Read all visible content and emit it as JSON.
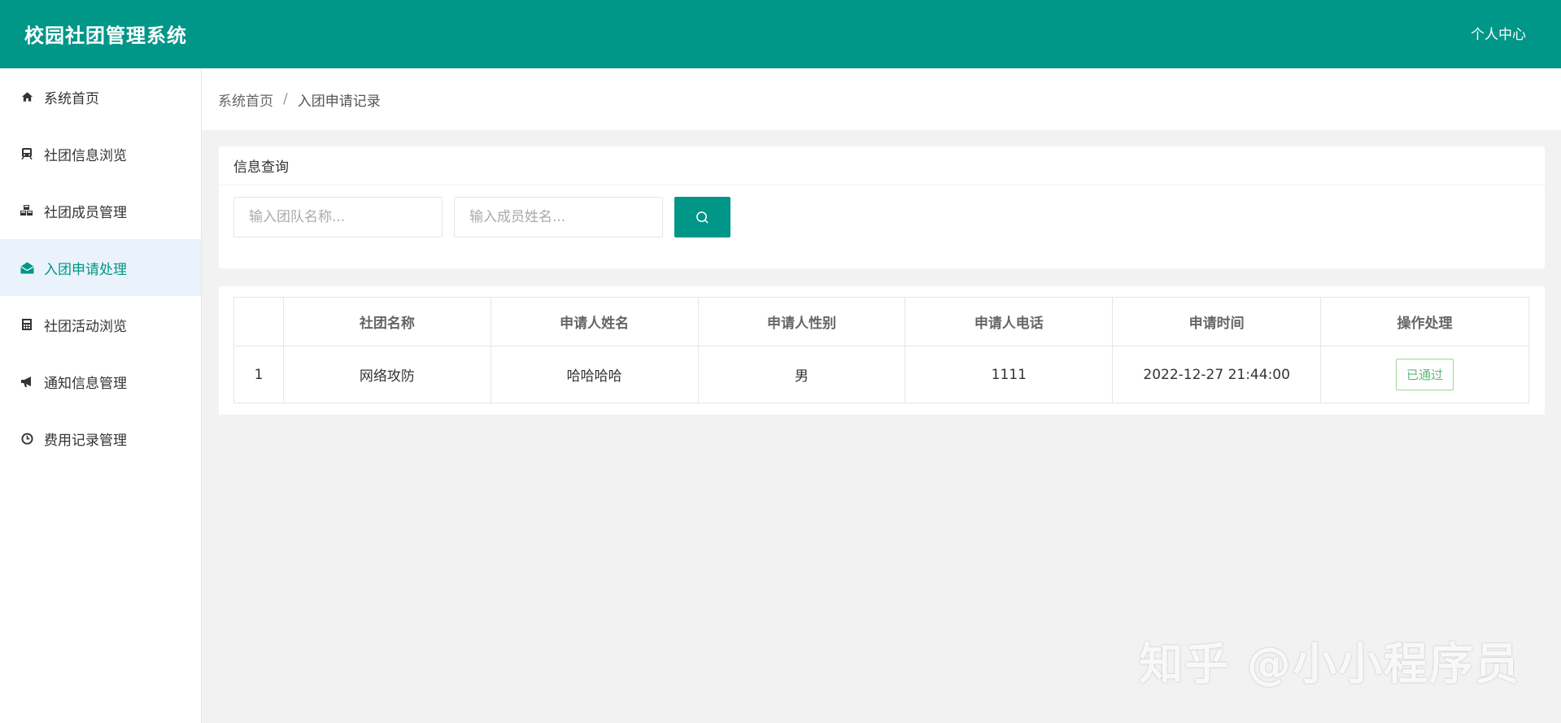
{
  "header": {
    "title": "校园社团管理系统",
    "user_center": "个人中心"
  },
  "sidebar": {
    "items": [
      {
        "label": "系统首页",
        "icon": "home-icon"
      },
      {
        "label": "社团信息浏览",
        "icon": "train-icon"
      },
      {
        "label": "社团成员管理",
        "icon": "cubes-icon"
      },
      {
        "label": "入团申请处理",
        "icon": "envelope-open-icon"
      },
      {
        "label": "社团活动浏览",
        "icon": "calculator-icon"
      },
      {
        "label": "通知信息管理",
        "icon": "bullhorn-icon"
      },
      {
        "label": "费用记录管理",
        "icon": "clock-icon"
      }
    ],
    "active_index": 3
  },
  "breadcrumb": {
    "home": "系统首页",
    "separator": "/",
    "current": "入团申请记录"
  },
  "query": {
    "title": "信息查询",
    "team_placeholder": "输入团队名称...",
    "member_placeholder": "输入成员姓名...",
    "search_icon": "search-icon"
  },
  "table": {
    "headers": [
      "",
      "社团名称",
      "申请人姓名",
      "申请人性别",
      "申请人电话",
      "申请时间",
      "操作处理"
    ],
    "rows": [
      {
        "index": "1",
        "club": "网络攻防",
        "name": "哈哈哈哈",
        "gender": "男",
        "phone": "1111",
        "time": "2022-12-27 21:44:00",
        "status": "已通过"
      }
    ]
  },
  "watermark": "知乎 @小小程序员",
  "colors": {
    "primary": "#009688",
    "active_bg": "#eaf3fb",
    "status_green": "#5fb878"
  }
}
